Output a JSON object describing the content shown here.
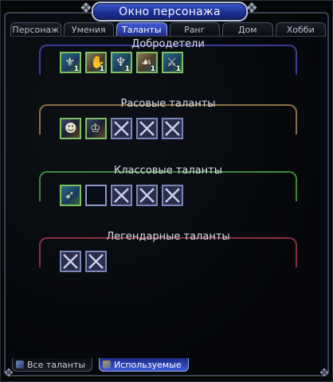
{
  "window": {
    "title": "Окно персонажа"
  },
  "tabs": [
    {
      "label": "Персонаж",
      "active": false
    },
    {
      "label": "Умения",
      "active": false
    },
    {
      "label": "Таланты",
      "active": true
    },
    {
      "label": "Ранг",
      "active": false
    },
    {
      "label": "Дом",
      "active": false
    },
    {
      "label": "Хобби",
      "active": false
    }
  ],
  "sections": {
    "virtues": {
      "title": "Добродетели",
      "color": "#3a3c9a",
      "slots": [
        {
          "state": "talent",
          "icon": "virtue-icon",
          "count": "1"
        },
        {
          "state": "talent",
          "icon": "virtue-icon",
          "count": "1"
        },
        {
          "state": "talent",
          "icon": "virtue-icon",
          "count": "1"
        },
        {
          "state": "talent",
          "icon": "virtue-icon",
          "count": "1"
        },
        {
          "state": "talent",
          "icon": "virtue-icon",
          "count": "1"
        }
      ]
    },
    "racial": {
      "title": "Расовые таланты",
      "color": "#8a7040",
      "slots": [
        {
          "state": "talent",
          "icon": "racial-talent-icon"
        },
        {
          "state": "talent",
          "icon": "racial-talent-icon"
        },
        {
          "state": "empty",
          "icon": "empty-slot-icon"
        },
        {
          "state": "empty",
          "icon": "empty-slot-icon"
        },
        {
          "state": "empty",
          "icon": "empty-slot-icon"
        }
      ]
    },
    "class": {
      "title": "Классовые таланты",
      "color": "#3a8a3a",
      "slots": [
        {
          "state": "talent",
          "icon": "class-talent-icon"
        },
        {
          "state": "blank",
          "icon": "blank-slot-icon"
        },
        {
          "state": "empty",
          "icon": "empty-slot-icon"
        },
        {
          "state": "empty",
          "icon": "empty-slot-icon"
        },
        {
          "state": "empty",
          "icon": "empty-slot-icon"
        }
      ]
    },
    "legendary": {
      "title": "Легендарные таланты",
      "color": "#8a3040",
      "slots": [
        {
          "state": "empty",
          "icon": "empty-slot-icon"
        },
        {
          "state": "empty",
          "icon": "empty-slot-icon"
        }
      ]
    }
  },
  "bottom_tabs": [
    {
      "label": "Все таланты",
      "active": false
    },
    {
      "label": "Используемые",
      "active": true
    }
  ],
  "colors": {
    "accent": "#2f47c0",
    "frame": "#3b4150"
  }
}
